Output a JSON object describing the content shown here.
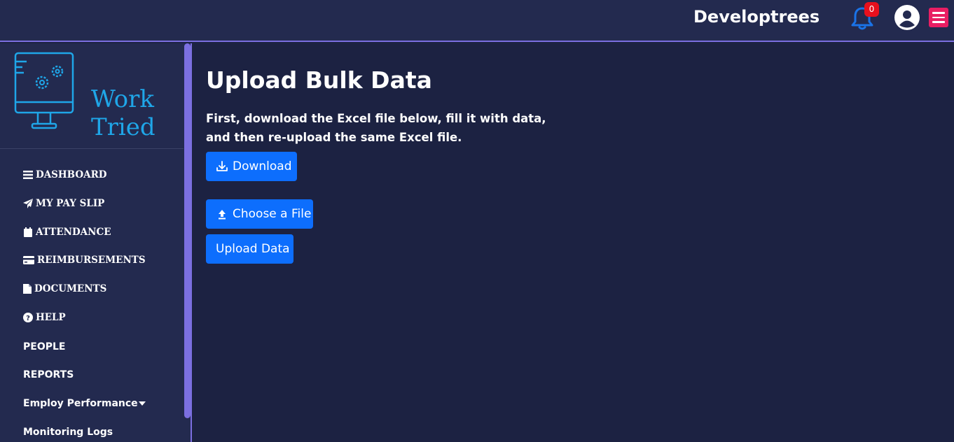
{
  "header": {
    "org_name": "Developtrees",
    "notification_count": "0",
    "icons": [
      "bell-icon",
      "user-avatar-icon",
      "hamburger-menu-icon"
    ],
    "colors": {
      "bar": "#232a4f",
      "accent_border": "#7b6fe0",
      "bell": "#1a73e8",
      "badge": "#e8101d",
      "menu_button": "#e91e63"
    }
  },
  "sidebar": {
    "logo_text": "Work Tried",
    "items": [
      {
        "label": "DASHBOARD",
        "icon": "list-icon"
      },
      {
        "label": "MY PAY SLIP",
        "icon": "paper-plane-icon"
      },
      {
        "label": "ATTENDANCE",
        "icon": "calendar-icon"
      },
      {
        "label": "REIMBURSEMENTS",
        "icon": "credit-card-icon"
      },
      {
        "label": "DOCUMENTS",
        "icon": "file-icon"
      },
      {
        "label": "HELP",
        "icon": "question-circle-icon"
      },
      {
        "label": "PEOPLE",
        "icon": ""
      },
      {
        "label": "REPORTS",
        "icon": ""
      },
      {
        "label": "Employ Performance",
        "icon": "caret-down-icon"
      },
      {
        "label": "Monitoring Logs",
        "icon": ""
      }
    ]
  },
  "main": {
    "title": "Upload Bulk Data",
    "instructions": "First, download the Excel file below, fill it with data, and then re-upload the same Excel file.",
    "download_label": "Download",
    "choose_file_label": "Choose a File",
    "upload_label": "Upload Data",
    "colors": {
      "background": "#1c2242",
      "button": "#0d6efd"
    }
  }
}
